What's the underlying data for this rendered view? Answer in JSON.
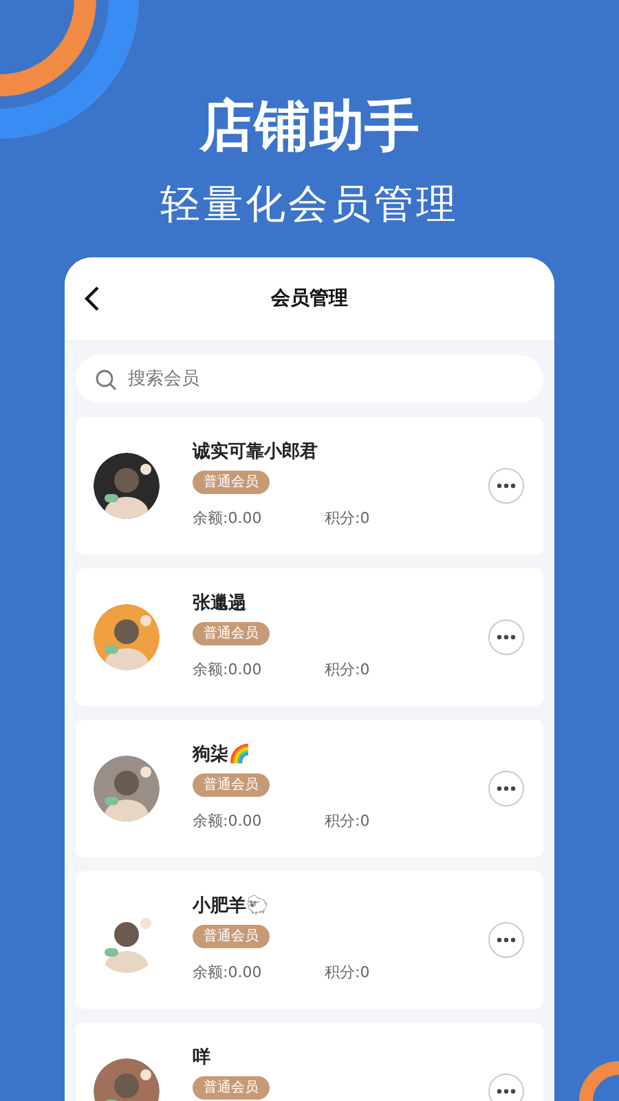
{
  "headline": "店铺助手",
  "subheadline": "轻量化会员管理",
  "screen": {
    "title": "会员管理",
    "search": {
      "placeholder": "搜索会员"
    },
    "members": [
      {
        "name": "诚实可靠小郎君",
        "badge": "普通会员",
        "balance": "余额:0.00",
        "points": "积分:0"
      },
      {
        "name": "张邋遢",
        "badge": "普通会员",
        "balance": "余额:0.00",
        "points": "积分:0"
      },
      {
        "name": "狗柒🌈",
        "badge": "普通会员",
        "balance": "余额:0.00",
        "points": "积分:0"
      },
      {
        "name": "小肥羊🐑",
        "badge": "普通会员",
        "balance": "余额:0.00",
        "points": "积分:0"
      },
      {
        "name": "咩",
        "badge": "普通会员"
      }
    ]
  }
}
